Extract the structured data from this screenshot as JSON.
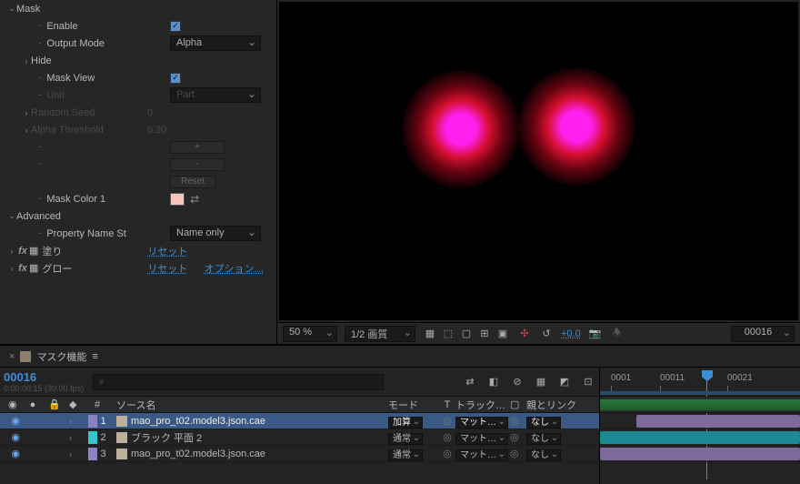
{
  "effects": {
    "group_mask": "Mask",
    "enable_label": "Enable",
    "output_mode_label": "Output Mode",
    "output_mode_value": "Alpha",
    "hide_label": "Hide",
    "mask_view_label": "Mask View",
    "unit_label": "Unit",
    "unit_value": "Part",
    "random_seed_label": "Random Seed",
    "random_seed_value": "0",
    "alpha_threshold_label": "Alpha Threshold",
    "alpha_threshold_value": "0.20",
    "plus": "+",
    "minus": "-",
    "reset_btn": "Reset",
    "mask_color_label": "Mask Color 1",
    "group_advanced": "Advanced",
    "prop_name_label": "Property Name St",
    "prop_name_value": "Name only",
    "fill_label": "塗り",
    "fill_reset": "リセット",
    "glow_label": "グロー",
    "glow_reset": "リセット",
    "glow_options": "オプション…"
  },
  "viewer": {
    "zoom": "50 %",
    "res": "1/2 画質",
    "exposure": "+0.0",
    "frame": "00016"
  },
  "timeline": {
    "panel_title": "マスク機能",
    "timecode": "00016",
    "fps": "0:00:00:15 (30.00 fps)",
    "search_placeholder": "",
    "col_idx": "#",
    "col_source": "ソース名",
    "col_mode": "モード",
    "col_t": "T",
    "col_track": "トラック…",
    "col_parent": "親とリンク",
    "layers": [
      {
        "idx": "1",
        "name": "mao_pro_t02.model3.json.cae",
        "mode": "加算",
        "track": "マット…",
        "parent": "なし",
        "color": "#8a83c2"
      },
      {
        "idx": "2",
        "name": "ブラック 平面 2",
        "mode": "通常",
        "track": "マット…",
        "parent": "なし",
        "color": "#36c4cf"
      },
      {
        "idx": "3",
        "name": "mao_pro_t02.model3.json.cae",
        "mode": "通常",
        "track": "マット…",
        "parent": "なし",
        "color": "#8a83c2"
      }
    ],
    "ticks": [
      "0001",
      "00011",
      "00021"
    ]
  }
}
